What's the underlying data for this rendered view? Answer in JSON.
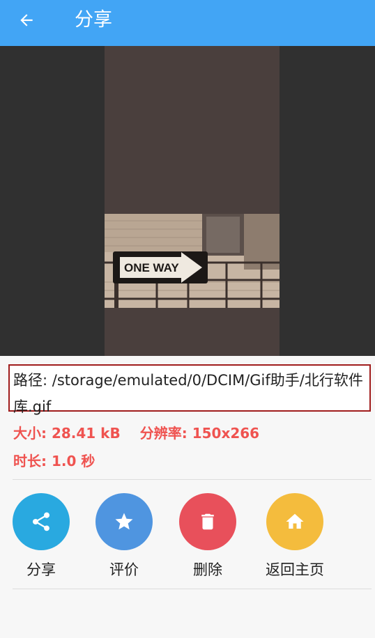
{
  "appbar": {
    "title": "分享"
  },
  "file": {
    "path": "路径: /storage/emulated/0/DCIM/Gif助手/北行软件库.gif",
    "size": "大小: 28.41 kB",
    "resolution": "分辨率: 150x266",
    "duration": "时长: 1.0 秒"
  },
  "preview": {
    "sign_text": "ONE WAY"
  },
  "actions": [
    {
      "label": "分享",
      "icon": "share-icon",
      "color": "#29a9e0"
    },
    {
      "label": "评价",
      "icon": "star-icon",
      "color": "#4f95e0"
    },
    {
      "label": "删除",
      "icon": "trash-icon",
      "color": "#e8505b"
    },
    {
      "label": "返回主页",
      "icon": "home-icon",
      "color": "#f4bc3d"
    }
  ],
  "colors": {
    "appbar": "#42a5f5",
    "meta_text": "#ef5350",
    "path_border": "#a01c1c"
  }
}
